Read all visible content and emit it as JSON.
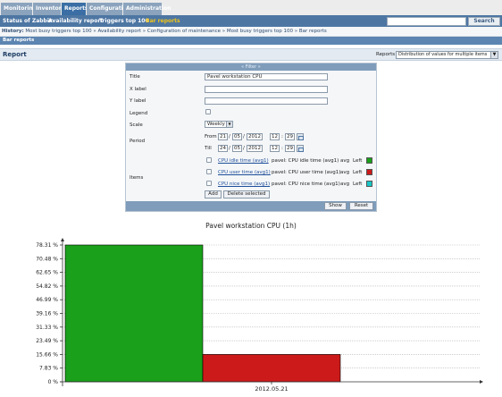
{
  "nav": {
    "tabs": [
      "Monitoring",
      "Inventory",
      "Reports",
      "Configuration",
      "Administration"
    ],
    "active_tab": "Reports",
    "sub_items": [
      "Status of Zabbix",
      "Availability report",
      "Triggers top 100",
      "Bar reports"
    ],
    "active_sub": "Bar reports",
    "search_button": "Search"
  },
  "history": {
    "label": "History:",
    "path": "Most busy triggers top 100 » Availability report » Configuration of maintenance » Most busy triggers top 100 » Bar reports"
  },
  "section_title": "Bar reports",
  "report": {
    "title": "Report",
    "selector_label": "Reports",
    "selector_value": "Distribution of values for multiple items"
  },
  "filter": {
    "header": "« Filter »",
    "title_label": "Title",
    "title_value": "Pavel workstation CPU",
    "xlabel_label": "X label",
    "xlabel_value": "",
    "ylabel_label": "Y label",
    "ylabel_value": "",
    "legend_label": "Legend",
    "scale_label": "Scale",
    "scale_value": "Weekly",
    "period_label": "Period",
    "from_label": "From",
    "from": {
      "day": "21",
      "month": "05",
      "year": "2012",
      "hour": "12",
      "minute": "29"
    },
    "till_label": "Till",
    "till": {
      "day": "24",
      "month": "05",
      "year": "2012",
      "hour": "12",
      "minute": "29"
    },
    "items_label": "Items",
    "items": [
      {
        "link": "CPU idle time (avg1)",
        "desc": "pavel: CPU idle time (avg1)",
        "func": "avg",
        "axis": "Left",
        "color": "#1aa01a"
      },
      {
        "link": "CPU user time (avg1)",
        "desc": "pavel: CPU user time (avg1)",
        "func": "avg",
        "axis": "Left",
        "color": "#cc1a1a"
      },
      {
        "link": "CPU nice time (avg1)",
        "desc": "pavel: CPU nice time (avg1)",
        "func": "avg",
        "axis": "Left",
        "color": "#1ac6c6"
      }
    ],
    "add_button": "Add",
    "delete_button": "Delete selected",
    "show_button": "Show",
    "reset_button": "Reset"
  },
  "chart_data": {
    "type": "bar",
    "title": "Pavel workstation CPU (1h)",
    "categories": [
      "2012.05.21"
    ],
    "series": [
      {
        "name": "CPU idle time (avg1)",
        "color": "#1aa01a",
        "values": [
          78.31
        ]
      },
      {
        "name": "CPU user time (avg1)",
        "color": "#cc1a1a",
        "values": [
          15.66
        ]
      },
      {
        "name": "CPU nice time (avg1)",
        "color": "#1ac6c6",
        "values": [
          0
        ]
      }
    ],
    "yticks": [
      "78.31 %",
      "70.48 %",
      "62.65 %",
      "54.82 %",
      "46.99 %",
      "39.16 %",
      "31.33 %",
      "23.49 %",
      "15.66 %",
      "7.83 %",
      "0 %"
    ],
    "ylim": [
      0,
      78.31
    ],
    "grid": true
  }
}
